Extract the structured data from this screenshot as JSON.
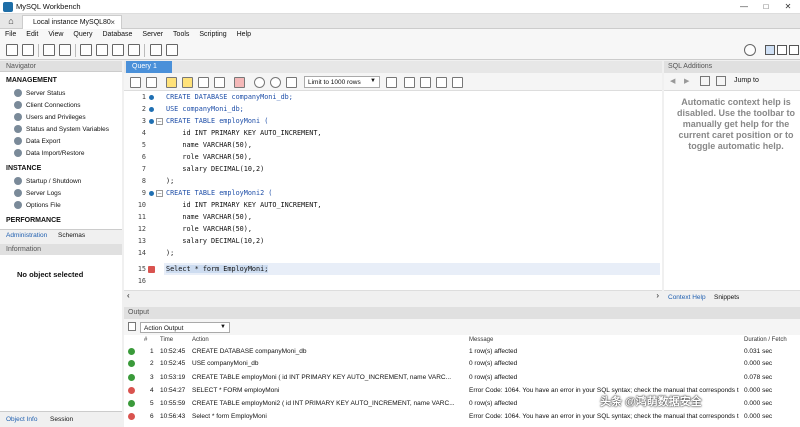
{
  "window": {
    "title": "MySQL Workbench"
  },
  "connection_tab": {
    "label": "Local instance MySQL80"
  },
  "menu": [
    "File",
    "Edit",
    "View",
    "Query",
    "Database",
    "Server",
    "Tools",
    "Scripting",
    "Help"
  ],
  "navigator": {
    "header": "Navigator",
    "management": {
      "title": "MANAGEMENT",
      "items": [
        "Server Status",
        "Client Connections",
        "Users and Privileges",
        "Status and System Variables",
        "Data Export",
        "Data Import/Restore"
      ]
    },
    "instance": {
      "title": "INSTANCE",
      "items": [
        "Startup / Shutdown",
        "Server Logs",
        "Options File"
      ]
    },
    "performance": {
      "title": "PERFORMANCE"
    },
    "tabs": [
      "Administration",
      "Schemas"
    ]
  },
  "information": {
    "header": "Information",
    "message": "No object selected"
  },
  "bottom_tabs": [
    "Object Info",
    "Session"
  ],
  "query_tab": {
    "label": "Query 1"
  },
  "query_toolbar": {
    "limit_label": "Limit to 1000 rows"
  },
  "editor": {
    "lines": [
      {
        "n": "1",
        "text": "CREATE DATABASE companyMoni_db;"
      },
      {
        "n": "2",
        "text": "USE companyMoni_db;"
      },
      {
        "n": "3",
        "text": "CREATE TABLE employMoni ("
      },
      {
        "n": "4",
        "text": "    id INT PRIMARY KEY AUTO_INCREMENT,"
      },
      {
        "n": "5",
        "text": "    name VARCHAR(50),"
      },
      {
        "n": "6",
        "text": "    role VARCHAR(50),"
      },
      {
        "n": "7",
        "text": "    salary DECIMAL(10,2)"
      },
      {
        "n": "8",
        "text": ");"
      },
      {
        "n": "9",
        "text": "CREATE TABLE employMoni2 ("
      },
      {
        "n": "10",
        "text": "    id INT PRIMARY KEY AUTO_INCREMENT,"
      },
      {
        "n": "11",
        "text": "    name VARCHAR(50),"
      },
      {
        "n": "12",
        "text": "    role VARCHAR(50),"
      },
      {
        "n": "13",
        "text": "    salary DECIMAL(10,2)"
      },
      {
        "n": "14",
        "text": ");"
      },
      {
        "n": "15",
        "text": "Select * form EmployMoni;"
      },
      {
        "n": "16",
        "text": ""
      }
    ]
  },
  "sql_additions": {
    "header": "SQL Additions",
    "jump_to": "Jump to",
    "help_text": "Automatic context help is disabled. Use the toolbar to manually get help for the current caret position or to toggle automatic help.",
    "tabs": [
      "Context Help",
      "Snippets"
    ]
  },
  "output": {
    "header": "Output",
    "selector": "Action Output",
    "columns": [
      "#",
      "Time",
      "Action",
      "Message",
      "Duration / Fetch"
    ],
    "rows": [
      {
        "status": "ok",
        "num": "1",
        "time": "10:52:45",
        "action": "CREATE DATABASE companyMoni_db",
        "message": "1 row(s) affected",
        "duration": "0.031 sec"
      },
      {
        "status": "ok",
        "num": "2",
        "time": "10:52:45",
        "action": "USE companyMoni_db",
        "message": "0 row(s) affected",
        "duration": "0.000 sec"
      },
      {
        "status": "ok",
        "num": "3",
        "time": "10:53:19",
        "action": "CREATE TABLE employMoni (     id INT PRIMARY KEY AUTO_INCREMENT,     name VARC...",
        "message": "0 row(s) affected",
        "duration": "0.078 sec"
      },
      {
        "status": "err",
        "num": "4",
        "time": "10:54:27",
        "action": "SELECT * FORM employMoni",
        "message": "Error Code: 1064. You have an error in your SQL syntax; check the manual that corresponds to ...",
        "duration": "0.000 sec"
      },
      {
        "status": "ok",
        "num": "5",
        "time": "10:55:59",
        "action": "CREATE TABLE employMoni2 (     id INT PRIMARY KEY AUTO_INCREMENT,     name VARC...",
        "message": "0 row(s) affected",
        "duration": "0.000 sec"
      },
      {
        "status": "err",
        "num": "6",
        "time": "10:56:43",
        "action": "Select * form EmployMoni",
        "message": "Error Code: 1064. You have an error in your SQL syntax; check the manual that corresponds to ...",
        "duration": "0.000 sec"
      }
    ]
  },
  "watermark": "头条 @鸿萌数据安全"
}
